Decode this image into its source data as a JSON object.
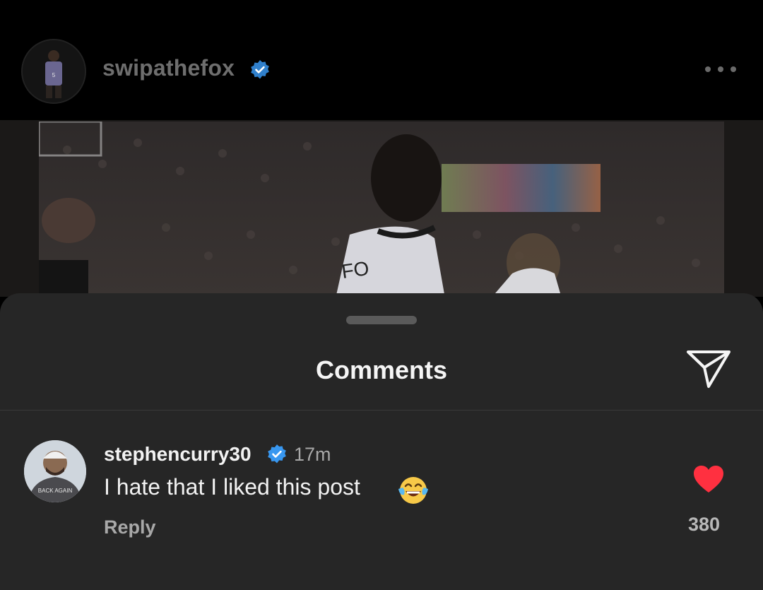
{
  "post": {
    "username": "swipathefox",
    "verified": true,
    "jersey_number": "5",
    "jersey_text": "FO"
  },
  "comments_sheet": {
    "title": "Comments",
    "share_icon": "paper-plane-icon"
  },
  "comment": {
    "username": "stephencurry30",
    "verified": true,
    "time": "17m",
    "text": "I hate that I liked this post",
    "emoji": "😂",
    "reply_label": "Reply",
    "like_count": "380",
    "liked": true,
    "avatar_shirt_text": "BACK AGAIN"
  },
  "colors": {
    "verified_blue": "#3897f0",
    "heart_red": "#ff3040",
    "sheet_bg": "#262626"
  }
}
